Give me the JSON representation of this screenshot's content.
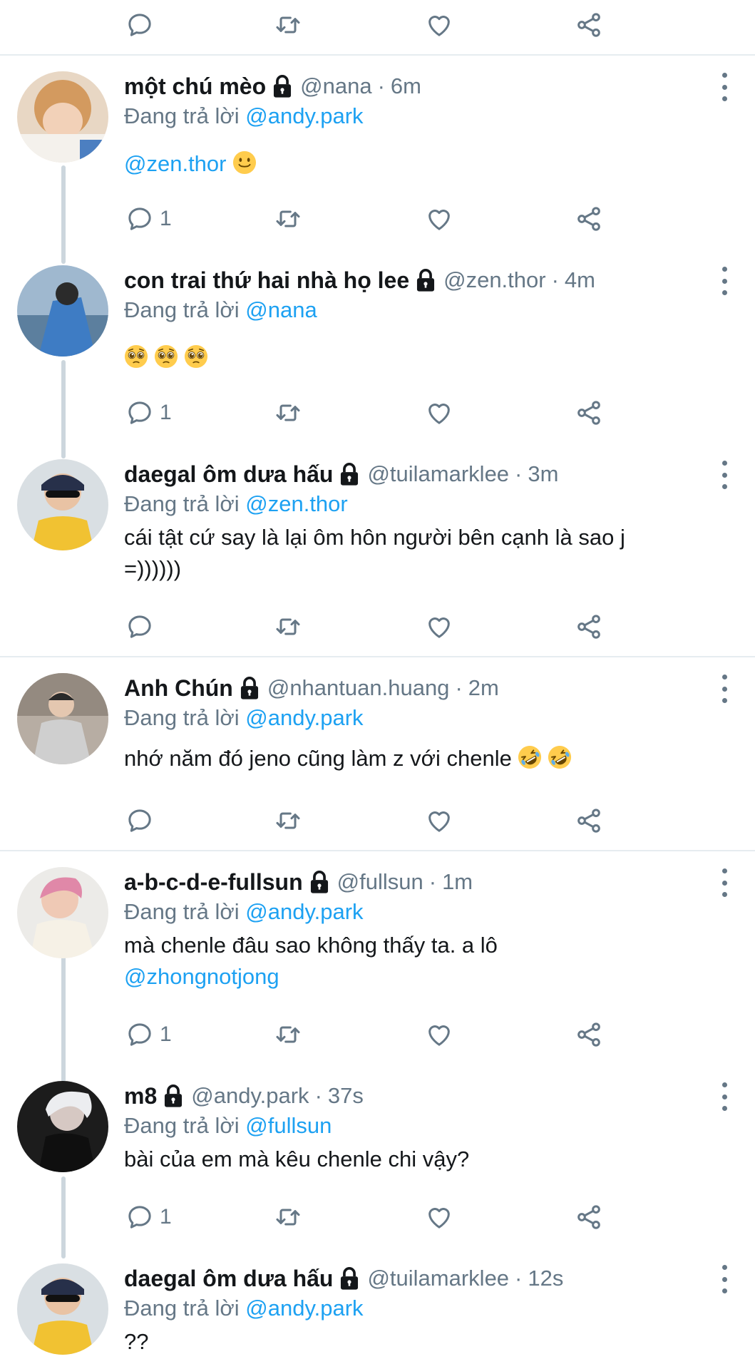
{
  "replying_prefix": "Đang trả lời",
  "tweets": [
    {
      "name": "một chú mèo",
      "handle": "@nana",
      "time": "6m",
      "reply_to": "@andy.park",
      "mention": "@zen.thor",
      "reply_count": "1",
      "emoji": "slightly-smiling-face"
    },
    {
      "name": "con trai thứ hai nhà họ lee",
      "handle": "@zen.thor",
      "time": "4m",
      "reply_to": "@nana",
      "reply_count": "1",
      "emoji": "pleading-face x3"
    },
    {
      "name": "daegal ôm dưa hấu",
      "handle": "@tuilamarklee",
      "time": "3m",
      "reply_to": "@zen.thor",
      "text_line1": "cái tật cứ say là lại ôm hôn người bên cạnh là sao j",
      "text_line2": "=))))))"
    },
    {
      "name": "Anh Chún",
      "handle": "@nhantuan.huang",
      "time": "2m",
      "reply_to": "@andy.park",
      "text": "nhớ năm đó jeno cũng làm z với chenle",
      "emoji": "rolling-on-floor-laughing x2"
    },
    {
      "name": "a-b-c-d-e-fullsun",
      "handle": "@fullsun",
      "time": "1m",
      "reply_to": "@andy.park",
      "text_line1": "mà chenle đâu sao không thấy ta. a lô",
      "mention": "@zhongnotjong",
      "reply_count": "1"
    },
    {
      "name": "m8",
      "handle": "@andy.park",
      "time": "37s",
      "reply_to": "@fullsun",
      "text": "bài của em mà kêu chenle chi vậy?",
      "reply_count": "1"
    },
    {
      "name": "daegal ôm dưa hấu",
      "handle": "@tuilamarklee",
      "time": "12s",
      "reply_to": "@andy.park",
      "text": "??"
    }
  ],
  "icons": {
    "reply": "reply-icon",
    "retweet": "retweet-icon",
    "like": "heart-icon",
    "share": "share-icon",
    "lock": "lock-icon",
    "more": "more-options-icon"
  },
  "colors": {
    "link": "#1da1f2",
    "muted": "#657786",
    "text": "#14171a",
    "divider": "#e6ecf0",
    "thread": "#ccd6dd"
  }
}
